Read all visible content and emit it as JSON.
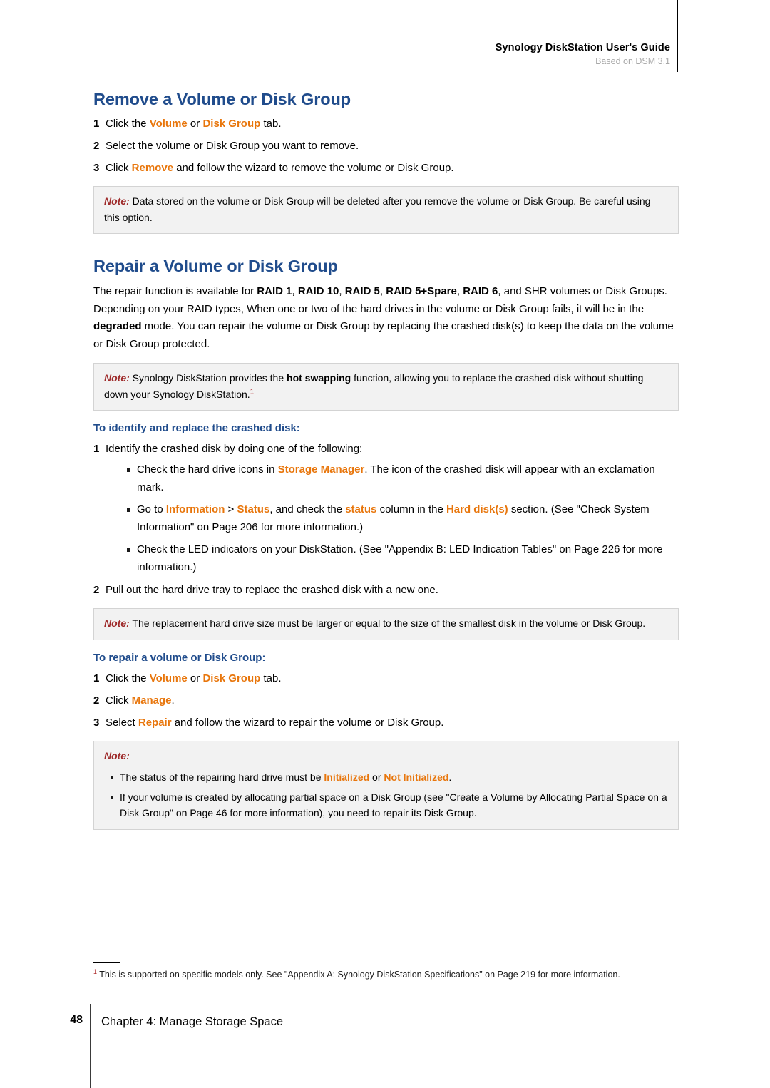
{
  "header": {
    "title": "Synology DiskStation User's Guide",
    "subtitle": "Based on DSM 3.1"
  },
  "colors": {
    "heading_blue": "#204c8c",
    "ui_orange": "#e8760c",
    "note_red": "#9e2a2a",
    "note_bg": "#f2f2f2",
    "note_border": "#d3d3d3"
  },
  "sections": {
    "remove": {
      "title": "Remove a Volume or Disk Group",
      "steps": [
        {
          "num": "1",
          "parts": [
            {
              "t": "Click the ",
              "s": "plain"
            },
            {
              "t": "Volume",
              "s": "ui"
            },
            {
              "t": " or ",
              "s": "plain"
            },
            {
              "t": "Disk Group",
              "s": "ui"
            },
            {
              "t": " tab.",
              "s": "plain"
            }
          ]
        },
        {
          "num": "2",
          "parts": [
            {
              "t": "Select the volume or Disk Group you want to remove.",
              "s": "plain"
            }
          ]
        },
        {
          "num": "3",
          "parts": [
            {
              "t": "Click ",
              "s": "plain"
            },
            {
              "t": "Remove",
              "s": "ui"
            },
            {
              "t": " and follow the wizard to remove the volume or Disk Group.",
              "s": "plain"
            }
          ]
        }
      ],
      "note": {
        "label": "Note:",
        "text": " Data stored on the volume or Disk Group will be deleted after you remove the volume or Disk Group. Be careful using this option."
      }
    },
    "repair": {
      "title": "Repair a Volume or Disk Group",
      "intro_parts": [
        {
          "t": "The repair function is available for ",
          "s": "plain"
        },
        {
          "t": "RAID 1",
          "s": "strong"
        },
        {
          "t": ", ",
          "s": "plain"
        },
        {
          "t": "RAID 10",
          "s": "strong"
        },
        {
          "t": ", ",
          "s": "plain"
        },
        {
          "t": "RAID 5",
          "s": "strong"
        },
        {
          "t": ", ",
          "s": "plain"
        },
        {
          "t": "RAID 5+Spare",
          "s": "strong"
        },
        {
          "t": ", ",
          "s": "plain"
        },
        {
          "t": "RAID 6",
          "s": "strong"
        },
        {
          "t": ", and SHR volumes or Disk Groups. Depending on your RAID types, When one or two of the hard drives in the volume or Disk Group fails, it will be in the ",
          "s": "plain"
        },
        {
          "t": "degraded",
          "s": "strong"
        },
        {
          "t": " mode. You can repair the volume or Disk Group by replacing the crashed disk(s) to keep the data on the volume or Disk Group protected.",
          "s": "plain"
        }
      ],
      "note_hotswap": {
        "label": "Note:",
        "parts": [
          {
            "t": " Synology DiskStation provides the ",
            "s": "plain"
          },
          {
            "t": "hot swapping",
            "s": "strong"
          },
          {
            "t": " function, allowing you to replace the crashed disk without shutting down your Synology DiskStation.",
            "s": "plain"
          },
          {
            "t": "1",
            "s": "footnote-ref"
          }
        ]
      },
      "identify": {
        "title": "To identify and replace the crashed disk:",
        "step1": {
          "num": "1",
          "text": "Identify the crashed disk by doing one of the following:"
        },
        "bullets": [
          [
            {
              "t": "Check the hard drive icons in ",
              "s": "plain"
            },
            {
              "t": "Storage Manager",
              "s": "ui"
            },
            {
              "t": ". The icon of the crashed disk will appear with an exclamation mark.",
              "s": "plain"
            }
          ],
          [
            {
              "t": "Go to ",
              "s": "plain"
            },
            {
              "t": "Information",
              "s": "ui"
            },
            {
              "t": " > ",
              "s": "plain"
            },
            {
              "t": "Status",
              "s": "ui"
            },
            {
              "t": ", and check the ",
              "s": "plain"
            },
            {
              "t": "status",
              "s": "ui"
            },
            {
              "t": " column in the ",
              "s": "plain"
            },
            {
              "t": "Hard disk(s)",
              "s": "ui"
            },
            {
              "t": " section. (See \"Check System Information\" on Page 206 for more information.)",
              "s": "plain"
            }
          ],
          [
            {
              "t": "Check the LED indicators on your DiskStation. (See \"Appendix B: LED Indication Tables\" on Page 226 for more information.)",
              "s": "plain"
            }
          ]
        ],
        "step2": {
          "num": "2",
          "text": "Pull out the hard drive tray to replace the crashed disk with a new one."
        }
      },
      "note_replacement": {
        "label": "Note:",
        "text": " The replacement hard drive size must be larger or equal to the size of the smallest disk in the volume or Disk Group."
      },
      "repair_steps": {
        "title": "To repair a volume or Disk Group:",
        "steps": [
          {
            "num": "1",
            "parts": [
              {
                "t": "Click the ",
                "s": "plain"
              },
              {
                "t": "Volume",
                "s": "ui"
              },
              {
                "t": " or ",
                "s": "plain"
              },
              {
                "t": "Disk Group",
                "s": "ui"
              },
              {
                "t": " tab.",
                "s": "plain"
              }
            ]
          },
          {
            "num": "2",
            "parts": [
              {
                "t": "Click ",
                "s": "plain"
              },
              {
                "t": "Manage",
                "s": "ui"
              },
              {
                "t": ".",
                "s": "plain"
              }
            ]
          },
          {
            "num": "3",
            "parts": [
              {
                "t": "Select ",
                "s": "plain"
              },
              {
                "t": "Repair",
                "s": "ui"
              },
              {
                "t": " and follow the wizard to repair the volume or Disk Group.",
                "s": "plain"
              }
            ]
          }
        ]
      },
      "note_final": {
        "label": "Note:",
        "bullets": [
          [
            {
              "t": "The status of the repairing hard drive must be ",
              "s": "plain"
            },
            {
              "t": "Initialized",
              "s": "ui"
            },
            {
              "t": " or ",
              "s": "plain"
            },
            {
              "t": "Not Initialized",
              "s": "ui"
            },
            {
              "t": ".",
              "s": "plain"
            }
          ],
          [
            {
              "t": "If your volume is created by allocating partial space on a Disk Group (see \"Create a Volume by Allocating Partial Space on a Disk Group\" on Page 46 for more information), you need to repair its Disk Group.",
              "s": "plain"
            }
          ]
        ]
      }
    }
  },
  "footnote": {
    "marker": "1",
    "text": " This is supported on specific models only. See \"Appendix A: Synology DiskStation Specifications\" on Page 219 for more information."
  },
  "footer": {
    "page_number": "48",
    "chapter": "Chapter 4: Manage Storage Space"
  }
}
